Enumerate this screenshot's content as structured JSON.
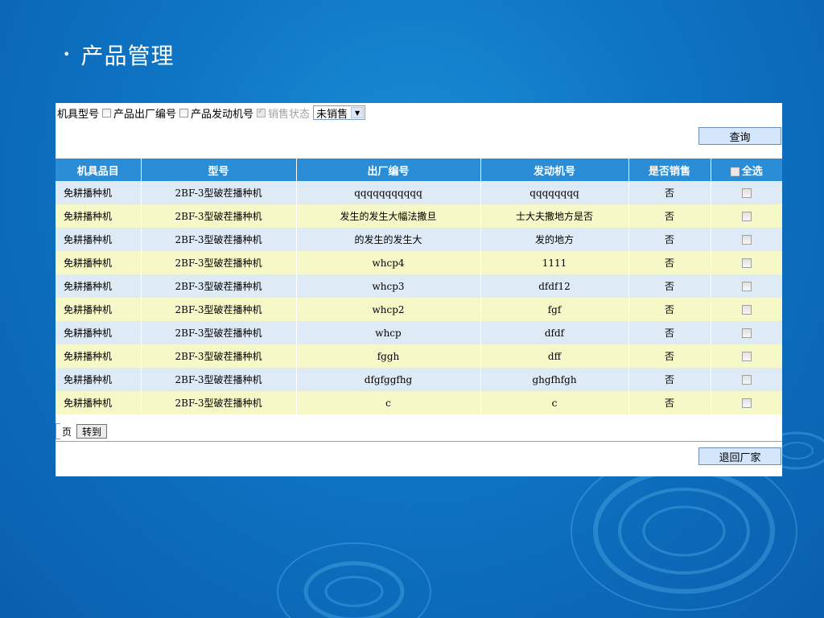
{
  "slide": {
    "bullet": "•",
    "title": "产品管理"
  },
  "filters": {
    "model_label": "机具型号",
    "serial_label": "产品出厂编号",
    "engine_label": "产品发动机号",
    "status_label": "销售状态",
    "status_select_value": "未销售",
    "query_button": "查询"
  },
  "table": {
    "headers": [
      "机具品目",
      "型号",
      "出厂编号",
      "发动机号",
      "是否销售",
      "全选"
    ],
    "rows": [
      [
        "免耕播种机",
        "2BF-3型破茬播种机",
        "qqqqqqqqqqq",
        "qqqqqqqq",
        "否"
      ],
      [
        "免耕播种机",
        "2BF-3型破茬播种机",
        "发生的发生大幅法撒旦",
        "士大夫撒地方是否",
        "否"
      ],
      [
        "免耕播种机",
        "2BF-3型破茬播种机",
        "的发生的发生大",
        "发的地方",
        "否"
      ],
      [
        "免耕播种机",
        "2BF-3型破茬播种机",
        "whcp4",
        "1111",
        "否"
      ],
      [
        "免耕播种机",
        "2BF-3型破茬播种机",
        "whcp3",
        "dfdf12",
        "否"
      ],
      [
        "免耕播种机",
        "2BF-3型破茬播种机",
        "whcp2",
        "fgf",
        "否"
      ],
      [
        "免耕播种机",
        "2BF-3型破茬播种机",
        "whcp",
        "dfdf",
        "否"
      ],
      [
        "免耕播种机",
        "2BF-3型破茬播种机",
        "fggh",
        "dff",
        "否"
      ],
      [
        "免耕播种机",
        "2BF-3型破茬播种机",
        "dfgfggfhg",
        "ghgfhfgh",
        "否"
      ],
      [
        "免耕播种机",
        "2BF-3型破茬播种机",
        "c",
        "c",
        "否"
      ]
    ]
  },
  "pager": {
    "page_label": "页",
    "goto_button": "转到"
  },
  "actions": {
    "back_button": "退回厂家"
  }
}
